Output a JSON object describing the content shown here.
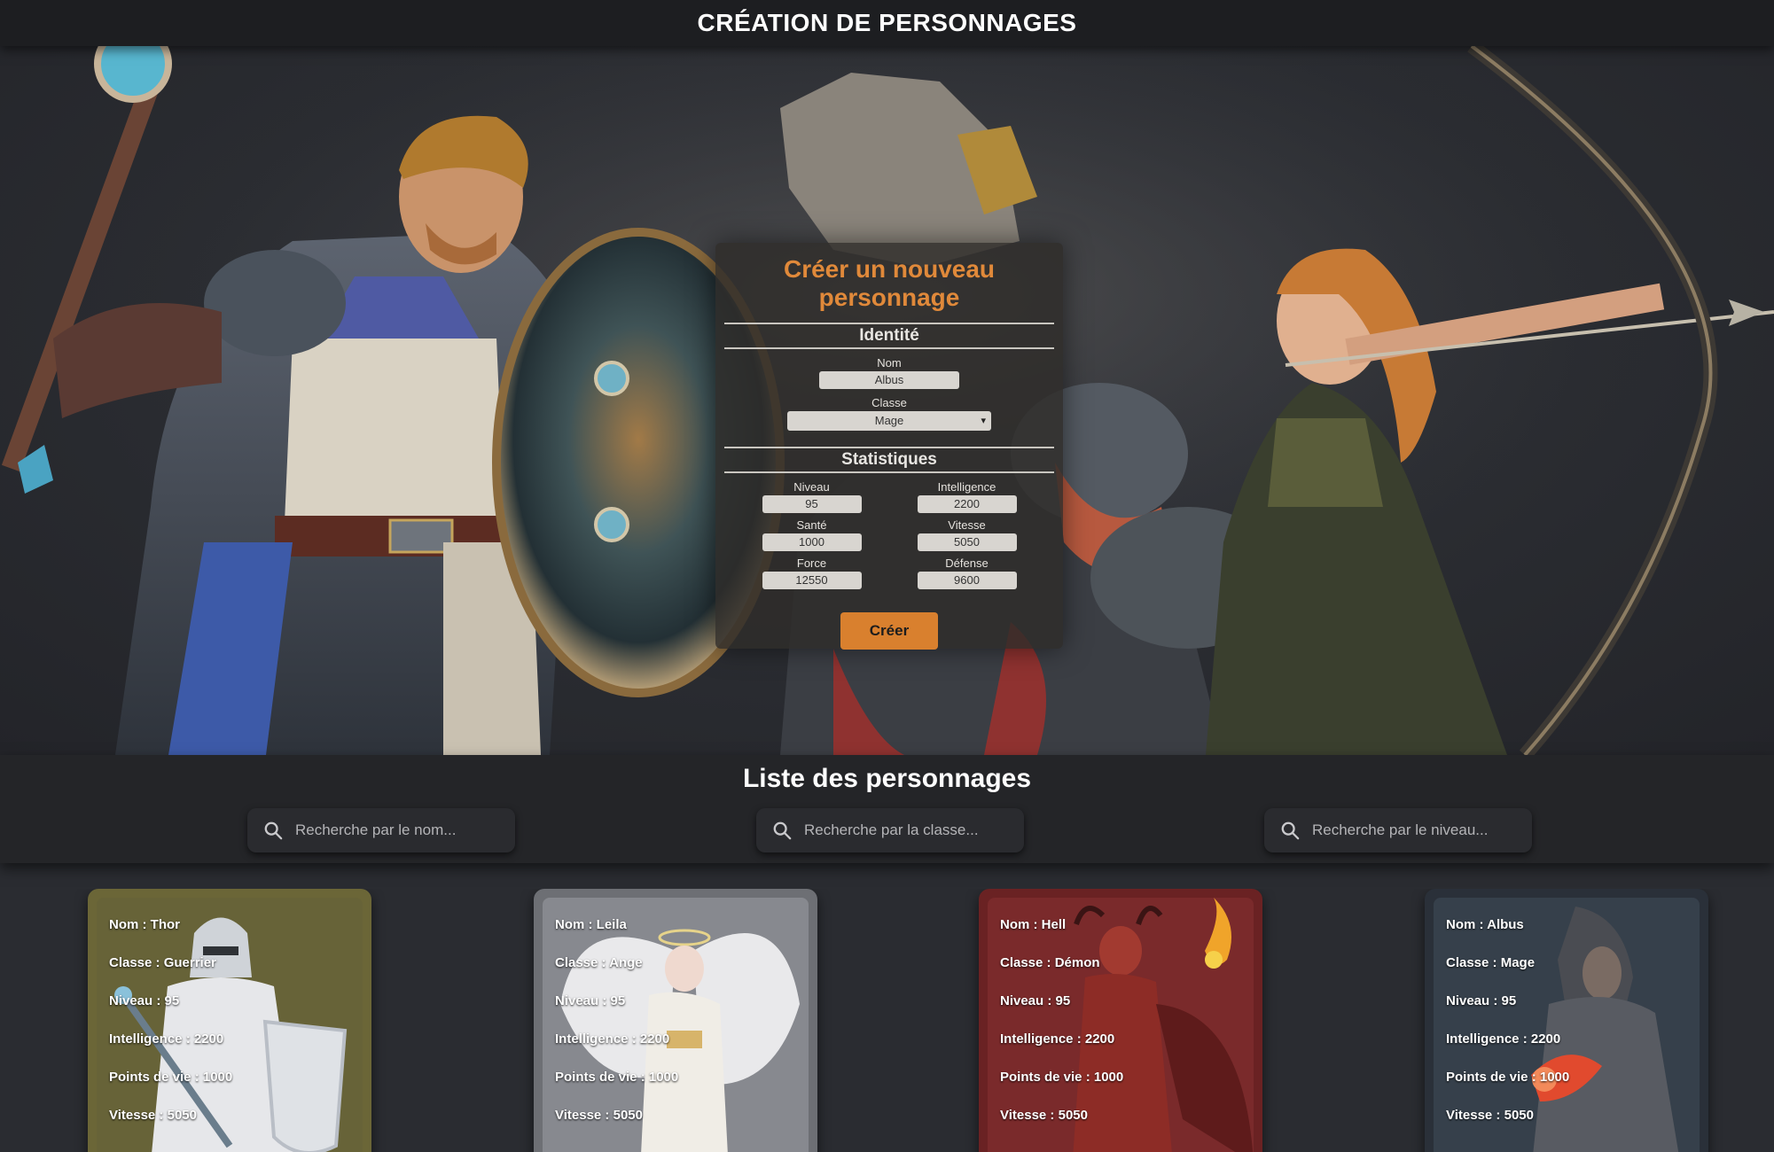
{
  "header": {
    "title": "CRÉATION DE PERSONNAGES"
  },
  "form": {
    "title": "Créer un nouveau personnage",
    "identity": {
      "heading": "Identité",
      "name_label": "Nom",
      "name_value": "Albus",
      "class_label": "Classe",
      "class_value": "Mage"
    },
    "stats": {
      "heading": "Statistiques",
      "level_label": "Niveau",
      "level_value": "95",
      "intelligence_label": "Intelligence",
      "intelligence_value": "2200",
      "health_label": "Santé",
      "health_value": "1000",
      "speed_label": "Vitesse",
      "speed_value": "5050",
      "strength_label": "Force",
      "strength_value": "12550",
      "defense_label": "Défense",
      "defense_value": "9600"
    },
    "submit_label": "Créer"
  },
  "list": {
    "title": "Liste des personnages",
    "search_name_placeholder": "Recherche par le nom...",
    "search_class_placeholder": "Recherche par la classe...",
    "search_level_placeholder": "Recherche par le niveau..."
  },
  "cards": [
    {
      "name": "Nom : Thor",
      "class": "Classe : Guerrier",
      "level": "Niveau : 95",
      "intelligence": "Intelligence : 2200",
      "hp": "Points de vie : 1000",
      "speed": "Vitesse : 5050",
      "frame_color": "#6b6637",
      "inner_color": "#676338"
    },
    {
      "name": "Nom : Leila",
      "class": "Classe : Ange",
      "level": "Niveau : 95",
      "intelligence": "Intelligence : 2200",
      "hp": "Points de vie : 1000",
      "speed": "Vitesse : 5050",
      "frame_color": "#6d6f74",
      "inner_color": "#87898f"
    },
    {
      "name": "Nom : Hell",
      "class": "Classe : Démon",
      "level": "Niveau : 95",
      "intelligence": "Intelligence : 2200",
      "hp": "Points de vie : 1000",
      "speed": "Vitesse : 5050",
      "frame_color": "#6a2223",
      "inner_color": "#7a2a2b"
    },
    {
      "name": "Nom : Albus",
      "class": "Classe : Mage",
      "level": "Niveau : 95",
      "intelligence": "Intelligence : 2200",
      "hp": "Points de vie : 1000",
      "speed": "Vitesse : 5050",
      "frame_color": "#2a3039",
      "inner_color": "#36404b"
    }
  ],
  "icons": {
    "search": "search-icon"
  }
}
